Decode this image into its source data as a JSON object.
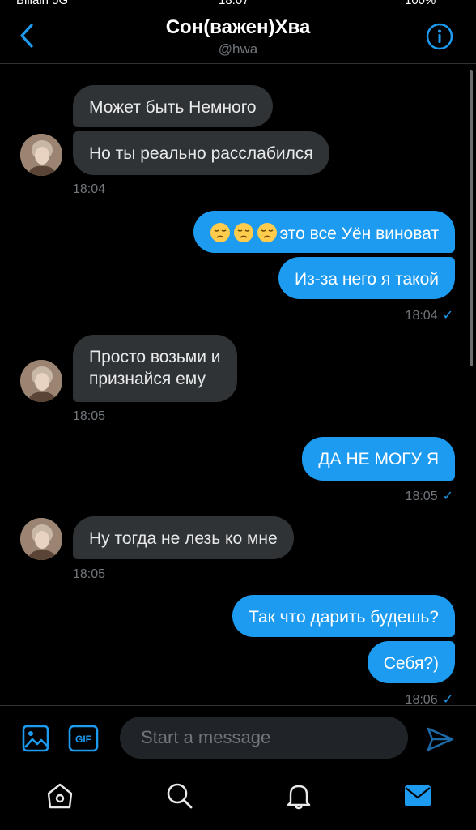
{
  "status_bar": {
    "carrier": "Billain 5G",
    "time": "18:07",
    "battery": "100%"
  },
  "header": {
    "title": "Сон(важен)Хва",
    "handle": "@hwa"
  },
  "messages": [
    {
      "text": "Может быть Немного"
    },
    {
      "text": "Но ты реально расслабился"
    },
    {
      "time": "18:04"
    },
    {
      "emoji": "😔😔😔",
      "text": "это все Уён виноват"
    },
    {
      "text": "Из-за него я такой"
    },
    {
      "time": "18:04",
      "status": "✓"
    },
    {
      "line1": "Просто возьми и",
      "line2": "признайся ему"
    },
    {
      "time": "18:05"
    },
    {
      "text": "ДА НЕ МОГУ Я"
    },
    {
      "time": "18:05",
      "status": "✓"
    },
    {
      "text": "Ну тогда не лезь ко мне"
    },
    {
      "time": "18:05"
    },
    {
      "text": "Так что дарить будешь?"
    },
    {
      "text": "Себя?)"
    },
    {
      "time": "18:06",
      "status": "✓"
    }
  ],
  "composer": {
    "placeholder": "Start a message",
    "gif_label": "GIF"
  },
  "colors": {
    "accent": "#1d9bf0",
    "incoming_bubble": "#2f3336",
    "background": "#000000"
  },
  "icons": {
    "back": "chevron-left-icon",
    "info": "info-circle-icon",
    "image": "image-icon",
    "gif": "gif-icon",
    "send": "send-icon",
    "home": "home-icon",
    "search": "search-icon",
    "notifications": "bell-icon",
    "messages": "mail-icon"
  }
}
